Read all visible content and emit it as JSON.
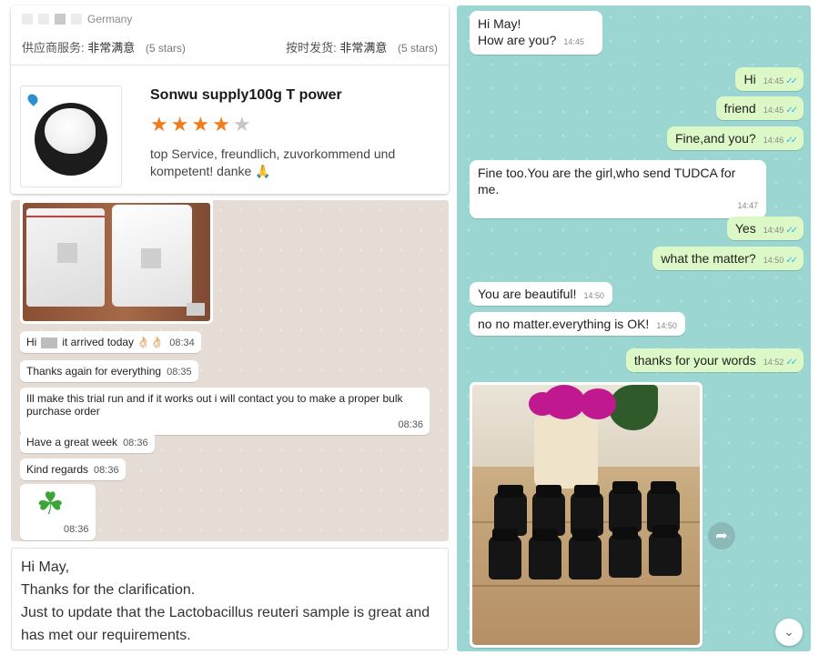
{
  "review": {
    "country": "Germany",
    "supplier_service_label": "供应商服务:",
    "supplier_service_value": "非常满意",
    "supplier_service_stars": "(5 stars)",
    "shipping_label": "按时发货:",
    "shipping_value": "非常满意",
    "shipping_stars": "(5 stars)",
    "product_title": "Sonwu supply100g T power",
    "rating": 4,
    "rating_max": 5,
    "text": "top Service, freundlich, zuvorkommend und kompetent! danke 🙏"
  },
  "chat_left": {
    "messages": [
      {
        "before": "Hi",
        "after": "it arrived today 👌🏻👌🏻",
        "time": "08:34"
      },
      {
        "text": "Thanks again for everything",
        "time": "08:35"
      },
      {
        "text": "Ill make this trial run and if it works out i will contact you to make a proper bulk purchase order",
        "time": "08:36"
      },
      {
        "text": "Have a great week",
        "time": "08:36"
      },
      {
        "text": "Kind regards",
        "time": "08:36"
      }
    ],
    "clover_time": "08:36"
  },
  "email": {
    "greeting": "Hi May,",
    "line1": "Thanks for the clarification.",
    "line2": "Just to update that the Lactobacillus reuteri sample is great and has met our requirements."
  },
  "chat_right": {
    "messages": [
      {
        "text": "Hi May!",
        "text2": "How are you?",
        "time": "14:45"
      },
      {
        "text": "Hi",
        "time": "14:45"
      },
      {
        "text": "friend",
        "time": "14:45"
      },
      {
        "text": "Fine,and you?",
        "time": "14:46"
      },
      {
        "text": "Fine too.You are the girl,who send TUDCA for me.",
        "time": "14:47"
      },
      {
        "text": "Yes",
        "time": "14:49"
      },
      {
        "text": "what the matter?",
        "time": "14:50"
      },
      {
        "text": "You are beautiful!",
        "time": "14:50"
      },
      {
        "text": "no no matter.everything is OK!",
        "time": "14:50"
      },
      {
        "text": "thanks for your words",
        "time": "14:52"
      }
    ],
    "ticks": "✓✓"
  },
  "colors": {
    "star_on": "#f07c1c",
    "star_off": "#c6c6c6",
    "outgoing_bubble": "#dcf8c6",
    "right_chat_bg": "#9bd6d2",
    "left_chat_bg": "#e5ddd5",
    "read_ticks": "#34b7f1"
  },
  "icons": {
    "star": "★",
    "forward": "➦",
    "scroll_down": "⌄",
    "clover": "☘"
  }
}
